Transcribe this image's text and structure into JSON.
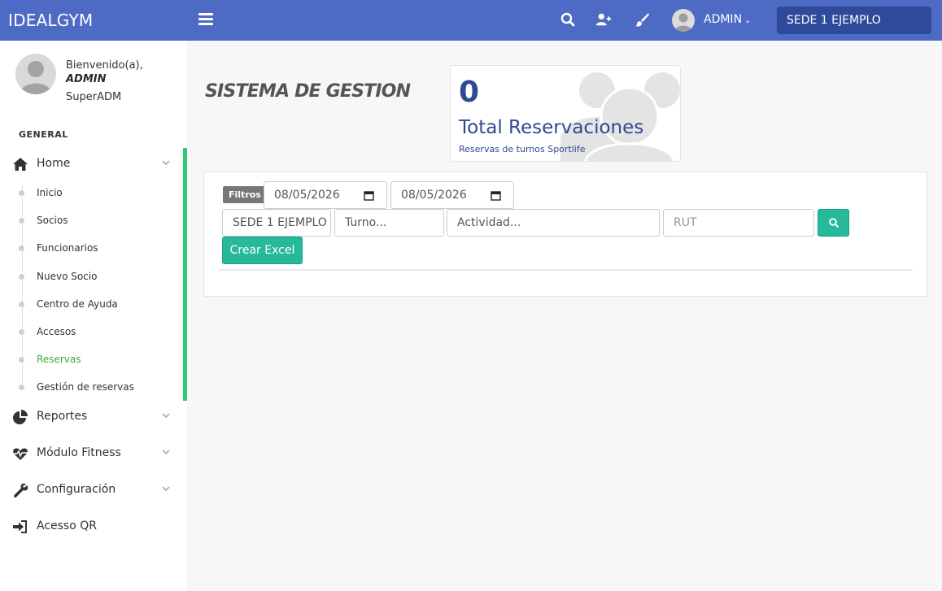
{
  "header": {
    "brand": "IDEALGYM",
    "user_name": "ADMIN",
    "sede": "SEDE 1 EJEMPLO"
  },
  "profile": {
    "welcome": "Bienvenido(a),",
    "name": "ADMIN",
    "role": "SuperADM"
  },
  "sidebar": {
    "section_title": "GENERAL",
    "home": "Home",
    "sub_items": [
      {
        "label": "Inicio"
      },
      {
        "label": "Socios"
      },
      {
        "label": "Funcionarios"
      },
      {
        "label": "Nuevo Socio"
      },
      {
        "label": "Centro de Ayuda"
      },
      {
        "label": "Accesos"
      },
      {
        "label": "Reservas"
      },
      {
        "label": "Gestión de reservas"
      }
    ],
    "active_item": "Reservas",
    "reportes": "Reportes",
    "fitness": "Módulo Fitness",
    "config": "Configuración",
    "qr": "Acesso QR"
  },
  "main": {
    "title": "SISTEMA DE GESTION",
    "stat": {
      "value": "0",
      "label": "Total Reservaciones",
      "sub": "Reservas de turnos Sportlife"
    },
    "filters": {
      "badge": "Filtros",
      "date_from": "08/05/2026",
      "date_to": "08/05/2026",
      "sede": "SEDE 1 EJEMPLO",
      "turno": "Turno...",
      "actividad": "Actividad...",
      "rut_placeholder": "RUT",
      "excel_button": "Crear Excel"
    }
  },
  "colors": {
    "header_bg": "#4d6bc4",
    "sede_bg": "#2f4a9b",
    "accent_green": "#26b99a",
    "active_bar": "#2ecc71",
    "active_text": "#3cab3c",
    "stat_text": "#2f4a8f"
  },
  "icons": [
    "menu-icon",
    "search-icon",
    "user-plus-icon",
    "paintbrush-icon",
    "home-icon",
    "pie-chart-icon",
    "heartbeat-icon",
    "wrench-icon",
    "sign-in-icon",
    "chevron-down-icon",
    "calendar-icon",
    "users-icon"
  ]
}
